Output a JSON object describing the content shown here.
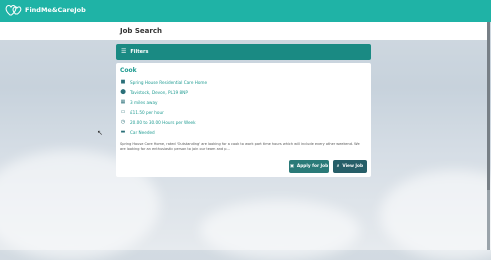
{
  "app": {
    "brand": "FindMe&CareJob"
  },
  "page": {
    "title": "Job Search"
  },
  "filters": {
    "label": "Filters"
  },
  "job": {
    "title": "Cook",
    "employer": "Spring House Residential Care Home",
    "location": "Tavistock, Devon, PL19 8NP",
    "distance": "3 miles away",
    "pay": "£11.50 per hour",
    "hours": "20.00 to 30.00 Hours per Week",
    "transport": "Car Needed",
    "description": "Spring House Care Home, rated 'Outstanding' are looking for a cook to work part time hours which will include every other weekend. We are looking for an enthusiastic person to join our team and p..."
  },
  "actions": {
    "apply": "Apply for Job",
    "view": "View Job"
  },
  "colors": {
    "brand": "#1fb3a6",
    "filters_bar": "#1a8a83",
    "accent_text": "#1e9b91",
    "button": "#2a7a78"
  }
}
